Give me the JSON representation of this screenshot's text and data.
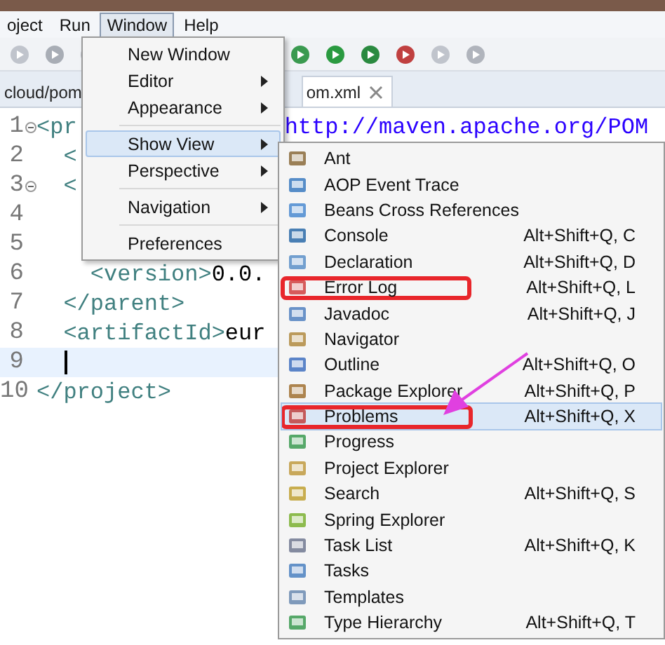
{
  "menu_bar": [
    {
      "label": "oject",
      "selected": false
    },
    {
      "label": "Run",
      "selected": false
    },
    {
      "label": "Window",
      "selected": true
    },
    {
      "label": "Help",
      "selected": false
    }
  ],
  "editor_tabs": [
    {
      "label": "cloud/pom",
      "selected": false,
      "closable": false
    },
    {
      "label": "om.xml",
      "selected": true,
      "closable": true
    }
  ],
  "editor": {
    "lines": [
      {
        "number": "1",
        "foldable": true,
        "current": false,
        "parts": [
          {
            "kind": "tag",
            "text": "<pr"
          },
          {
            "kind": "url",
            "text": "http://maven.apache.org/POM"
          }
        ]
      },
      {
        "number": "2",
        "foldable": false,
        "current": false,
        "parts": [
          {
            "kind": "tag",
            "text": "  <"
          }
        ]
      },
      {
        "number": "3",
        "foldable": true,
        "current": false,
        "parts": [
          {
            "kind": "tag",
            "text": "  <"
          }
        ]
      },
      {
        "number": "4",
        "foldable": false,
        "current": false
      },
      {
        "number": "5",
        "foldable": false,
        "current": false
      },
      {
        "number": "6",
        "foldable": false,
        "current": false,
        "parts": [
          {
            "kind": "tag",
            "text": "    <version>"
          },
          {
            "kind": "text",
            "text": "0.0."
          }
        ]
      },
      {
        "number": "7",
        "foldable": false,
        "current": false,
        "parts": [
          {
            "kind": "tag",
            "text": "  </parent>"
          }
        ]
      },
      {
        "number": "8",
        "foldable": false,
        "current": false,
        "parts": [
          {
            "kind": "tag",
            "text": "  <artifactId>"
          },
          {
            "kind": "text",
            "text": "eur"
          }
        ]
      },
      {
        "number": "9",
        "foldable": false,
        "current": true
      },
      {
        "number": "10",
        "foldable": false,
        "current": false,
        "parts": [
          {
            "kind": "tag",
            "text": "</project>"
          }
        ]
      }
    ]
  },
  "window_menu": {
    "items": [
      {
        "kind": "item",
        "label": "New Window",
        "submenu": false,
        "selected": false
      },
      {
        "kind": "item",
        "label": "Editor",
        "submenu": true,
        "selected": false
      },
      {
        "kind": "item",
        "label": "Appearance",
        "submenu": true,
        "selected": false
      },
      {
        "kind": "separator"
      },
      {
        "kind": "item",
        "label": "Show View",
        "submenu": true,
        "selected": true
      },
      {
        "kind": "item",
        "label": "Perspective",
        "submenu": true,
        "selected": false
      },
      {
        "kind": "separator"
      },
      {
        "kind": "item",
        "label": "Navigation",
        "submenu": true,
        "selected": false
      },
      {
        "kind": "separator"
      },
      {
        "kind": "item",
        "label": "Preferences",
        "submenu": false,
        "selected": false
      }
    ]
  },
  "show_view_menu": {
    "items": [
      {
        "label": "Ant",
        "selected": false,
        "highlighted": false
      },
      {
        "label": "AOP Event Trace",
        "selected": false,
        "highlighted": false
      },
      {
        "label": "Beans Cross References",
        "selected": false,
        "highlighted": false
      },
      {
        "label": "Console",
        "shortcut": "Alt+Shift+Q, C",
        "selected": false,
        "highlighted": false
      },
      {
        "label": "Declaration",
        "shortcut": "Alt+Shift+Q, D",
        "selected": false,
        "highlighted": false
      },
      {
        "label": "Error Log",
        "shortcut": "Alt+Shift+Q, L",
        "selected": false,
        "highlighted": true
      },
      {
        "label": "Javadoc",
        "shortcut": "Alt+Shift+Q, J",
        "selected": false,
        "highlighted": false
      },
      {
        "label": "Navigator",
        "selected": false,
        "highlighted": false
      },
      {
        "label": "Outline",
        "shortcut": "Alt+Shift+Q, O",
        "selected": false,
        "highlighted": false
      },
      {
        "label": "Package Explorer",
        "shortcut": "Alt+Shift+Q, P",
        "selected": false,
        "highlighted": false
      },
      {
        "label": "Problems",
        "shortcut": "Alt+Shift+Q, X",
        "selected": true,
        "highlighted": true
      },
      {
        "label": "Progress",
        "selected": false,
        "highlighted": false
      },
      {
        "label": "Project Explorer",
        "selected": false,
        "highlighted": false
      },
      {
        "label": "Search",
        "shortcut": "Alt+Shift+Q, S",
        "selected": false,
        "highlighted": false
      },
      {
        "label": "Spring Explorer",
        "selected": false,
        "highlighted": false
      },
      {
        "label": "Task List",
        "shortcut": "Alt+Shift+Q, K",
        "selected": false,
        "highlighted": false
      },
      {
        "label": "Tasks",
        "selected": false,
        "highlighted": false
      },
      {
        "label": "Templates",
        "selected": false,
        "highlighted": false
      },
      {
        "label": "Type Hierarchy",
        "shortcut": "Alt+Shift+Q, T",
        "selected": false,
        "highlighted": false
      }
    ]
  }
}
